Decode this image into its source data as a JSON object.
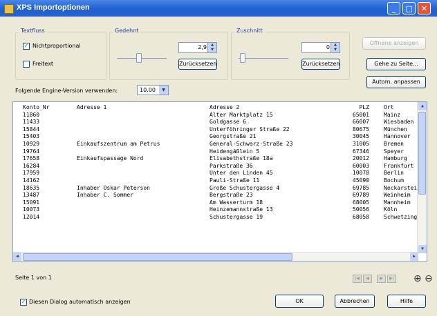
{
  "window": {
    "title": "XPS Importoptionen"
  },
  "textfluss": {
    "group_label": "Textfluss",
    "nichtproportional": {
      "label": "Nichtproportional",
      "checked": true
    },
    "freitext": {
      "label": "Freitext",
      "checked": false
    }
  },
  "gedehnt": {
    "group_label": "Gedehnt",
    "value": "2,9",
    "reset_label": "Zurücksetzen"
  },
  "zuschnitt": {
    "group_label": "Zuschnitt",
    "value": "0",
    "reset_label": "Zurücksetzen"
  },
  "engine": {
    "label": "Folgende Engine-Version verwenden:",
    "value": "10.00"
  },
  "right_buttons": {
    "abnormal": "Offnene anzeigen",
    "goto_page": "Gehe zu Seite...",
    "auto_adjust": "Autom. anpassen"
  },
  "table": {
    "headers": [
      "Konto_Nr",
      "Adresse 1",
      "Adresse 2",
      "PLZ",
      "Ort"
    ],
    "rows": [
      [
        "11860",
        "",
        "Alter Marktplatz 15",
        "65001",
        "Mainz"
      ],
      [
        "11433",
        "",
        "Goldgasse 6",
        "66007",
        "Wiesbaden"
      ],
      [
        "15844",
        "",
        "Unterföhringer Straße 22",
        "80675",
        "München"
      ],
      [
        "15403",
        "",
        "Georgstraße 21",
        "30045",
        "Hannover"
      ],
      [
        "10929",
        "Einkaufszentrum am Petrus",
        "General-Schwarz-Straße 23",
        "31005",
        "Bremen"
      ],
      [
        "19764",
        "",
        "Heidengäßlein 5",
        "67346",
        "Speyer"
      ],
      [
        "17658",
        "Einkaufspassage Nord",
        "Elisabethstraße 18a",
        "20012",
        "Hamburg"
      ],
      [
        "16284",
        "",
        "Parkstraße 36",
        "60003",
        "Frankfurt a.M"
      ],
      [
        "17959",
        "",
        "Unter den Linden 45",
        "10078",
        "Berlin"
      ],
      [
        "14162",
        "",
        "Pauli-Straße 11",
        "45090",
        "Bochum"
      ],
      [
        "18635",
        "Inhaber Oskar Peterson",
        "Große Schustergasse 4",
        "69785",
        "Neckarsteinach"
      ],
      [
        "13487",
        "Inhaber C. Sommer",
        "Bergstraße 23",
        "69789",
        "Weinheim"
      ],
      [
        "15091",
        "",
        "Am Wasserturm 18",
        "68005",
        "Mannheim"
      ],
      [
        "10073",
        "",
        "Heinzemannstraße 13",
        "50056",
        "Köln"
      ],
      [
        "12014",
        "",
        "Schustergasse 19",
        "68058",
        "Schwetzingen"
      ]
    ]
  },
  "status": {
    "page_text": "Seite 1 von 1"
  },
  "footer": {
    "auto_show_label": "Diesen Dialog automatisch anzeigen",
    "auto_show_checked": true,
    "ok_label": "OK",
    "cancel_label": "Abbrechen",
    "help_label": "Hilfe"
  }
}
